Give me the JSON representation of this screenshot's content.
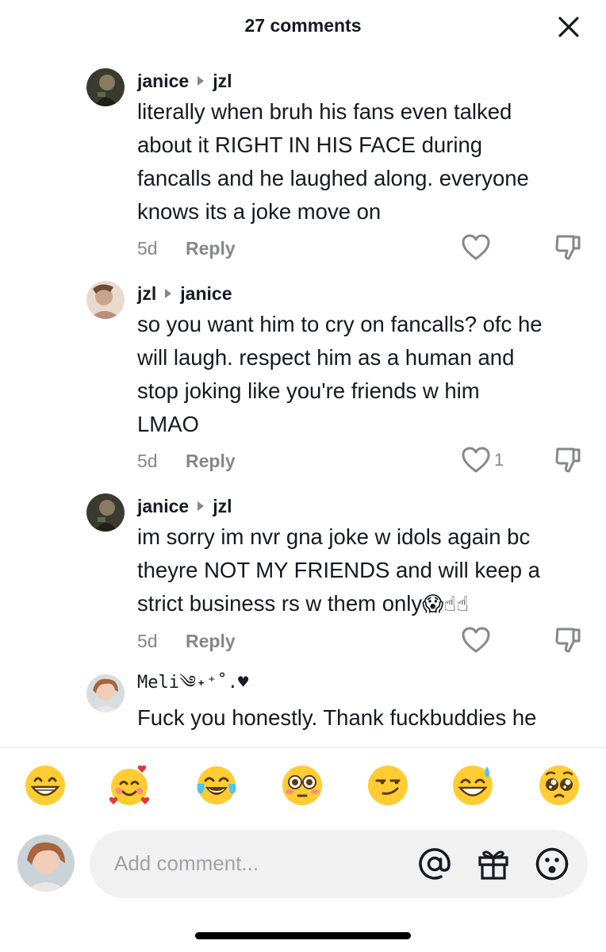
{
  "header": {
    "title": "27 comments"
  },
  "comments": [
    {
      "user": "janice",
      "reply_to": "jzl",
      "lines": [
        "literally when bruh his fans even talked",
        "about it RIGHT IN HIS FACE during",
        "fancalls and he laughed along. everyone",
        "knows its a joke move on"
      ],
      "time": "5d",
      "reply_label": "Reply"
    },
    {
      "user": "jzl",
      "reply_to": "janice",
      "lines": [
        "so you want him to cry on fancalls? ofc he",
        "will laugh. respect him as a human and",
        "stop joking like you're friends w him",
        "LMAO"
      ],
      "time": "5d",
      "reply_label": "Reply",
      "likes": "1"
    },
    {
      "user": "janice",
      "reply_to": "jzl",
      "lines": [
        "im sorry im nvr gna joke w idols again bc",
        "theyre NOT MY FRIENDS and will keep a",
        "strict business rs w them only"
      ],
      "emojis": "😱☝☝",
      "time": "5d",
      "reply_label": "Reply"
    },
    {
      "user": "Meli༄˖⁺˚.♥",
      "lines": [
        "Fuck you honestly. Thank fuckbuddies he"
      ]
    }
  ],
  "emoji_bar": [
    "grinning-face",
    "smiling-face-with-hearts",
    "tears-of-joy",
    "flushed-face",
    "smirking-face",
    "sweat-smile",
    "pleading-face"
  ],
  "input": {
    "placeholder": "Add comment..."
  },
  "icons": [
    "close-icon",
    "mention-icon",
    "gift-icon",
    "emoji-icon",
    "heart-icon",
    "dislike-icon"
  ]
}
